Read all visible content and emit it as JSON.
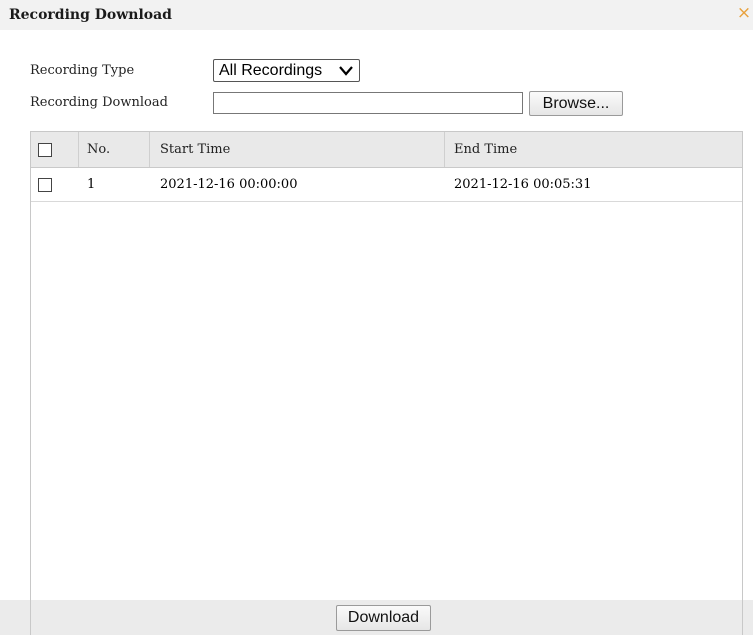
{
  "dialog": {
    "title": "Recording Download",
    "close_glyph": "×"
  },
  "form": {
    "recording_type_label": "Recording Type",
    "recording_type_value": "All Recordings",
    "recording_download_label": "Recording Download",
    "path_value": "",
    "browse_label": "Browse..."
  },
  "table": {
    "columns": [
      "No.",
      "Start Time",
      "End Time"
    ],
    "rows": [
      {
        "no": "1",
        "start": "2021-12-16 00:00:00",
        "end": "2021-12-16 00:05:31",
        "checked": false
      }
    ]
  },
  "footer": {
    "download_label": "Download"
  },
  "icons": {
    "close": "close-icon",
    "dropdown": "chevron-down-icon"
  },
  "colors": {
    "close_accent": "#e8a13c"
  }
}
